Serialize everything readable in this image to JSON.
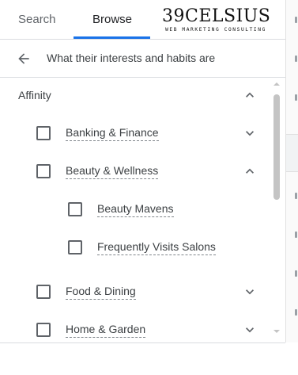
{
  "tabs": [
    {
      "label": "Search",
      "active": false
    },
    {
      "label": "Browse",
      "active": true
    }
  ],
  "brand": {
    "name": "39CELSIUS",
    "tagline": "WEB MARKETING CONSULTING"
  },
  "back_row": {
    "title": "What their interests and habits are",
    "icon": "arrow-back-icon"
  },
  "section": {
    "label": "Affinity",
    "expanded": true
  },
  "categories": [
    {
      "label": "Banking & Finance",
      "checked": false,
      "expanded": false
    },
    {
      "label": "Beauty & Wellness",
      "checked": false,
      "expanded": true,
      "children": [
        {
          "label": "Beauty Mavens",
          "checked": false
        },
        {
          "label": "Frequently Visits Salons",
          "checked": false
        }
      ]
    },
    {
      "label": "Food & Dining",
      "checked": false,
      "expanded": false
    },
    {
      "label": "Home & Garden",
      "checked": false,
      "expanded": false
    }
  ],
  "colors": {
    "accent": "#1a73e8",
    "text": "#3c4043",
    "muted": "#5f6368",
    "divider": "#dadce0",
    "scrollbar": "#c4c4c4"
  }
}
